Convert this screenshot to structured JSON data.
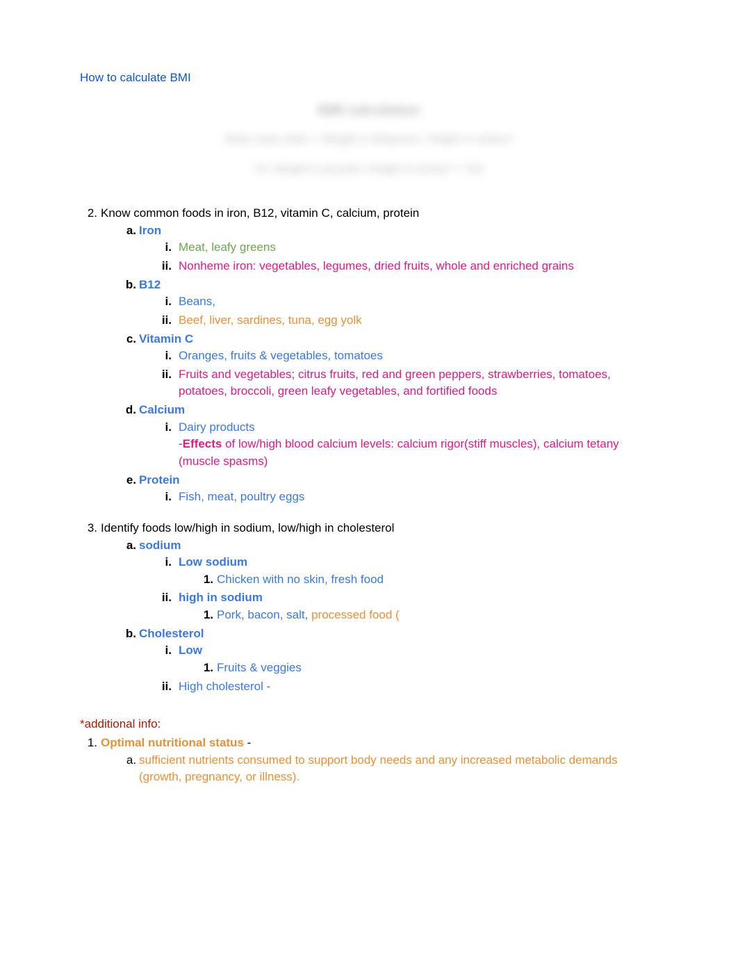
{
  "header": {
    "bmi_link": "How to calculate BMI"
  },
  "blurred": {
    "line1": "BMI calculation",
    "line2": "Body mass index = Weight in kilograms / Height in meters²",
    "line3": "Or: Weight in pounds / Height in inches² × 703"
  },
  "section2": {
    "number": "2.",
    "title": "Know common foods in iron, B12, vitamin C, calcium, protein",
    "items": {
      "a": {
        "marker": "a.",
        "label": "Iron",
        "i": {
          "marker": "i.",
          "text": "Meat, leafy greens"
        },
        "ii": {
          "marker": "ii.",
          "text": "Nonheme iron: vegetables, legumes, dried fruits, whole and enriched grains"
        }
      },
      "b": {
        "marker": "b.",
        "label": "B12",
        "i": {
          "marker": "i.",
          "text": "Beans,"
        },
        "ii": {
          "marker": "ii.",
          "text": "Beef, liver, sardines, tuna, egg yolk"
        }
      },
      "c": {
        "marker": "c.",
        "label": "Vitamin C",
        "i": {
          "marker": "i.",
          "text": "Oranges, fruits & vegetables, tomatoes"
        },
        "ii": {
          "marker": "ii.",
          "text": "Fruits and vegetables; citrus fruits, red and green peppers, strawberries, tomatoes, potatoes, broccoli, green leafy vegetables, and fortified foods"
        }
      },
      "d": {
        "marker": "d.",
        "label": "Calcium",
        "i": {
          "marker": "i.",
          "text": "Dairy products"
        },
        "effects_prefix": "-",
        "effects_bold": "Effects",
        "effects_text": " of low/high blood calcium levels: calcium rigor(stiff muscles), calcium tetany (muscle spasms)"
      },
      "e": {
        "marker": "e.",
        "label": "Protein",
        "i": {
          "marker": "i.",
          "text": "Fish, meat, poultry eggs"
        }
      }
    }
  },
  "section3": {
    "number": "3.",
    "title": "Identify foods low/high in sodium, low/high in cholesterol",
    "items": {
      "a": {
        "marker": "a.",
        "label": "sodium",
        "i": {
          "marker": "i.",
          "label": "Low sodium",
          "sub1": {
            "marker": "1.",
            "text": "Chicken with no skin, fresh food"
          }
        },
        "ii": {
          "marker": "ii.",
          "label": "high in sodium",
          "sub1": {
            "marker": "1.",
            "text_blue": "Pork, bacon, salt, ",
            "text_orange": "processed food ("
          }
        }
      },
      "b": {
        "marker": "b.",
        "label": "Cholesterol",
        "i": {
          "marker": "i.",
          "label": "Low",
          "sub1": {
            "marker": "1.",
            "text": "Fruits & veggies"
          }
        },
        "ii": {
          "marker": "ii.",
          "text": "High cholesterol -"
        }
      }
    }
  },
  "additional": {
    "heading": "*additional info:",
    "item1": {
      "marker": "1.",
      "label": "Optimal nutritional status",
      "dash": " -",
      "a": {
        "marker": "a.",
        "text": "sufficient nutrients consumed to support body needs and any increased metabolic demands (growth, pregnancy, or illness)."
      }
    }
  }
}
